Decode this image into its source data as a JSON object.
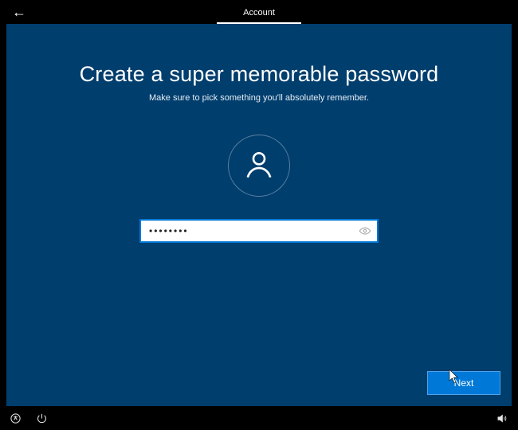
{
  "topbar": {
    "tab_label": "Account"
  },
  "main": {
    "heading": "Create a super memorable password",
    "subheading": "Make sure to pick something you'll absolutely remember.",
    "password_value": "••••••••",
    "next_label": "Next"
  },
  "colors": {
    "panel_bg": "#003e6e",
    "accent": "#0078d7"
  }
}
